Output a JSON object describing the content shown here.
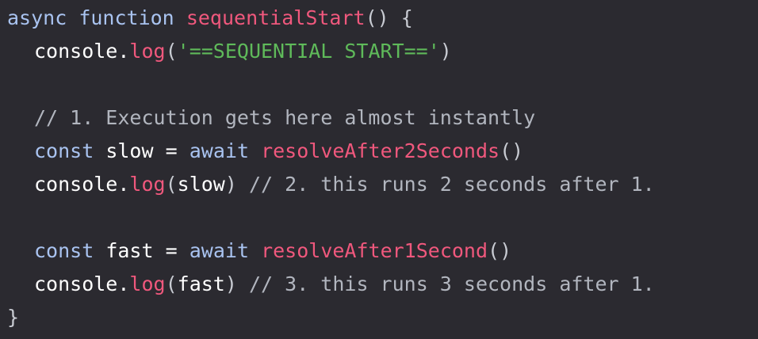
{
  "code": {
    "line1": {
      "kw1": "async",
      "kw2": "function",
      "name": "sequentialStart",
      "rest": "() {"
    },
    "line2": {
      "obj": "console",
      "dot": ".",
      "method": "log",
      "open": "(",
      "str": "'==SEQUENTIAL START=='",
      "close": ")"
    },
    "line4": {
      "comment": "// 1. Execution gets here almost instantly"
    },
    "line5": {
      "kw": "const",
      "var": "slow",
      "eq": "=",
      "await": "await",
      "call": "resolveAfter2Seconds",
      "parens": "()"
    },
    "line6": {
      "obj": "console",
      "dot": ".",
      "method": "log",
      "open": "(",
      "arg": "slow",
      "close": ")",
      "comment": "// 2. this runs 2 seconds after 1."
    },
    "line8": {
      "kw": "const",
      "var": "fast",
      "eq": "=",
      "await": "await",
      "call": "resolveAfter1Second",
      "parens": "()"
    },
    "line9": {
      "obj": "console",
      "dot": ".",
      "method": "log",
      "open": "(",
      "arg": "fast",
      "close": ")",
      "comment": "// 3. this runs 3 seconds after 1."
    },
    "line10": {
      "brace": "}"
    }
  },
  "colors": {
    "background": "#2b2a30",
    "keyword": "#a9c3f0",
    "function": "#f0587d",
    "string": "#5fba5a",
    "comment": "#b2b6bf",
    "plain": "#ffffff"
  }
}
